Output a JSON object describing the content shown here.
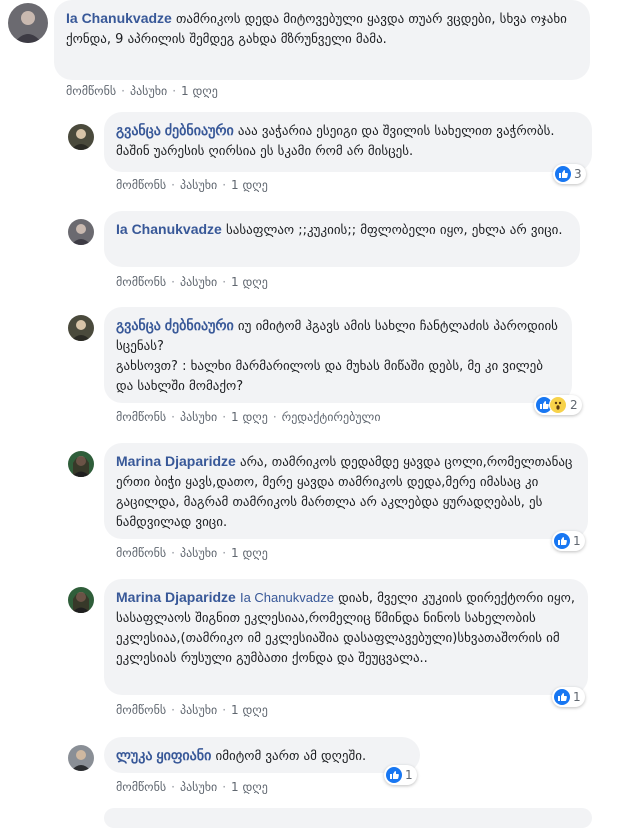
{
  "actions": {
    "like": "მომწონს",
    "reply": "პასუხი",
    "time": "1 დღე",
    "edited": "რედაქტირებული"
  },
  "comments": [
    {
      "author": "Ia Chanukvadze",
      "text": "თამრიკოს დედა მიტოვებული ყავდა თუარ ვცდები, სხვა ოჯახი ქონდა, 9 აპრილის შემდეგ გახდა მზრუნველი მამა."
    },
    {
      "author": "გვანცა ძებნიაური",
      "text": "ააა ვაჭარია ესეიგი და შვილის სახელით ვაჭრობს. მაშინ უარესის ღირსია ეს სკამი რომ არ მისცეს.",
      "reaction_count": "3"
    },
    {
      "author": "Ia Chanukvadze",
      "text": "სასაფლაო ;;კუკიის;; მფლობელი იყო, ეხლა არ ვიცი."
    },
    {
      "author": "გვანცა ძებნიაური",
      "text": "იუ იმიტომ ჰგავს ამის სახლი ჩანტლაძის პაროდიის სცენას?",
      "text2": "გახსოვთ? : ხალხი მარმარილოს და მუხას მიწაში დებს, მე კი ვილებ და სახლში მომაქო?",
      "reaction_count": "2"
    },
    {
      "author": "Marina Djaparidze",
      "text": "არა, თამრიკოს დედამდე ყავდა ცოლი,რომელთანაც ერთი ბიჭი ყავს,დათო, მერე ყავდა თამრიკოს დედა,მერე იმასაც კი გაცილდა, მაგრამ თამრიკოს მართლა არ აკლებდა ყურადღებას, ეს ნამდვილად ვიცი.",
      "reaction_count": "1"
    },
    {
      "author": "Marina Djaparidze",
      "mention": "Ia Chanukvadze",
      "text": "დიახ, მველი კუკიის დირექტორი იყო, სასაფლაოს შიგნით ეკლესიაა,რომელიც წმინდა ნინოს სახელობის ეკლესიაა,(თამრიკო იმ ეკლესიაშია დასაფლავებული)სხვათაშორის იმ ეკლესიას რუსული გუმბათი ქონდა და შეუცვალა..",
      "reaction_count": "1"
    },
    {
      "author": "ლუკა ყიფიანი",
      "text": "იმიტომ ვართ ამ დღეში.",
      "reaction_count": "1"
    }
  ],
  "colors": {
    "link": "#385898",
    "bubble": "#f2f3f5",
    "like_blue": "#1877f2"
  }
}
